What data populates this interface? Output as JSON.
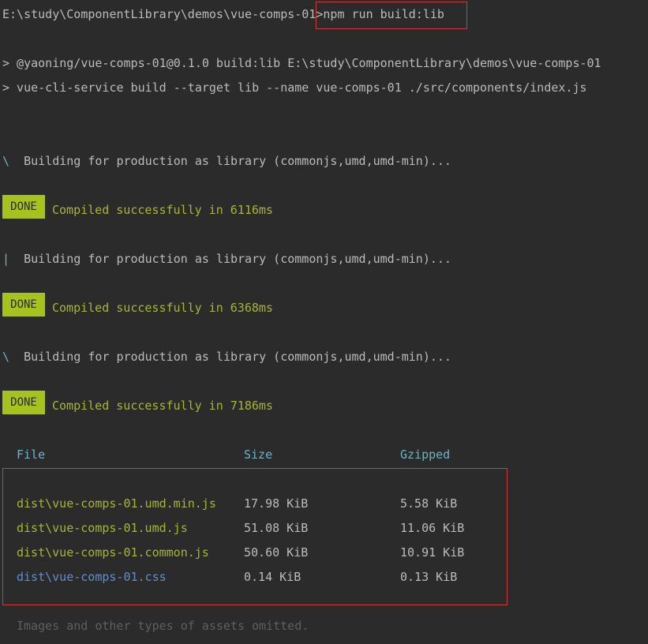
{
  "terminal": {
    "prompt_path": "E:\\study\\ComponentLibrary\\demos\\vue-comps-01>",
    "command": "npm run build:lib",
    "script_line": "> @yaoning/vue-comps-01@0.1.0 build:lib E:\\study\\ComponentLibrary\\demos\\vue-comps-01",
    "service_line": "> vue-cli-service build --target lib --name vue-comps-01 ./src/components/index.js",
    "builds": [
      {
        "spinner": "\\",
        "building": "Building for production as library (commonjs,umd,umd-min)...",
        "badge": "DONE",
        "result": "Compiled successfully in 6116ms"
      },
      {
        "spinner": "|",
        "building": "Building for production as library (commonjs,umd,umd-min)...",
        "badge": "DONE",
        "result": "Compiled successfully in 6368ms"
      },
      {
        "spinner": "\\",
        "building": "Building for production as library (commonjs,umd,umd-min)...",
        "badge": "DONE",
        "result": "Compiled successfully in 7186ms"
      }
    ],
    "table": {
      "headers": {
        "file": "File",
        "size": "Size",
        "gzipped": "Gzipped"
      },
      "rows": [
        {
          "file": "dist\\vue-comps-01.umd.min.js",
          "size": "17.98 KiB",
          "gzipped": "5.58 KiB"
        },
        {
          "file": "dist\\vue-comps-01.umd.js",
          "size": "51.08 KiB",
          "gzipped": "11.06 KiB"
        },
        {
          "file": "dist\\vue-comps-01.common.js",
          "size": "50.60 KiB",
          "gzipped": "10.91 KiB"
        },
        {
          "file": "dist\\vue-comps-01.css",
          "size": "0.14 KiB",
          "gzipped": "0.13 KiB"
        }
      ]
    },
    "footer": "Images and other types of assets omitted.",
    "colors": {
      "background": "#2b2b2b",
      "done_badge": "#a5c21f",
      "highlight_border": "#d23a3a"
    }
  }
}
